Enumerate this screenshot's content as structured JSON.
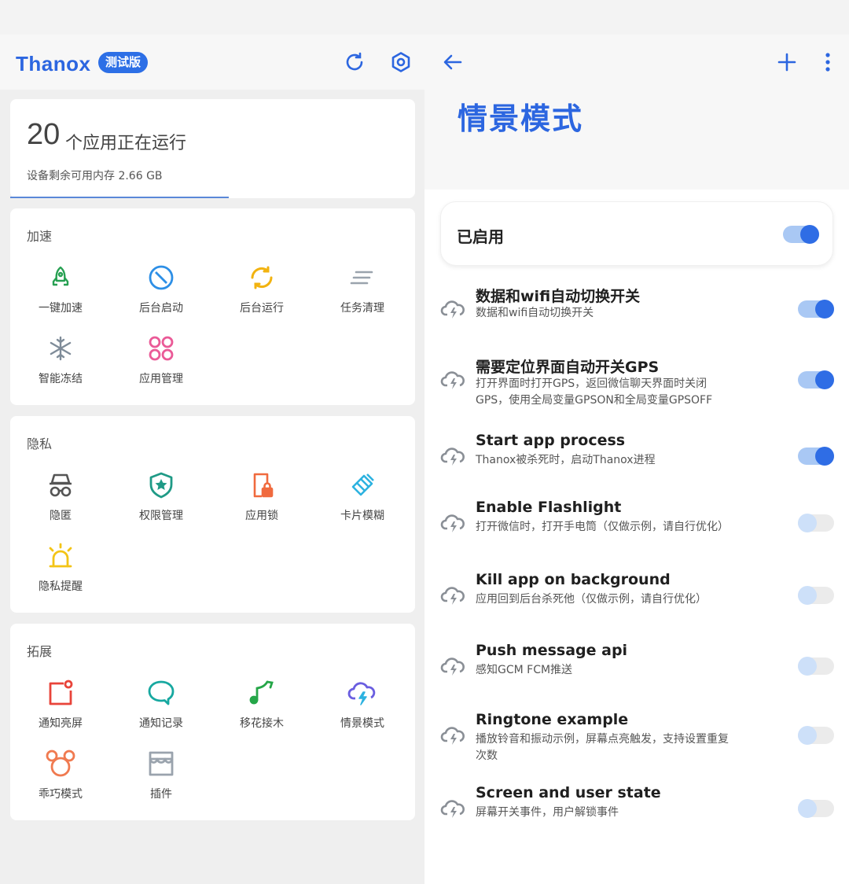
{
  "left": {
    "brand": "Thanox",
    "badge": "测试版",
    "toolbar_icons": [
      "refresh-icon",
      "settings-icon"
    ],
    "memory": {
      "count": "20",
      "label": "个应用正在运行",
      "available": "设备剩余可用内存 2.66 GB",
      "progress": 0.54
    },
    "sections": [
      {
        "title": "加速",
        "items": [
          {
            "label": "一键加速",
            "icon": "rocket-icon",
            "color": "#27a052"
          },
          {
            "label": "后台启动",
            "icon": "block-icon",
            "color": "#2d8fe6"
          },
          {
            "label": "后台运行",
            "icon": "sync-icon",
            "color": "#f2b310"
          },
          {
            "label": "任务清理",
            "icon": "clear-all-icon",
            "color": "#9aa3ad"
          },
          {
            "label": "智能冻结",
            "icon": "snowflake-icon",
            "color": "#7f8c99"
          },
          {
            "label": "应用管理",
            "icon": "apps-grid-icon",
            "color": "#ea5a97"
          }
        ]
      },
      {
        "title": "隐私",
        "items": [
          {
            "label": "隐匿",
            "icon": "incognito-icon",
            "color": "#555555"
          },
          {
            "label": "权限管理",
            "icon": "shield-star-icon",
            "color": "#1f9a86"
          },
          {
            "label": "应用锁",
            "icon": "phone-lock-icon",
            "color": "#f06a3e"
          },
          {
            "label": "卡片模糊",
            "icon": "eraser-icon",
            "color": "#2db2e0"
          },
          {
            "label": "隐私提醒",
            "icon": "alarm-light-icon",
            "color": "#f3c416"
          }
        ]
      },
      {
        "title": "拓展",
        "items": [
          {
            "label": "通知亮屏",
            "icon": "notification-badge-icon",
            "color": "#e8443a"
          },
          {
            "label": "通知记录",
            "icon": "chat-bubble-icon",
            "color": "#17a8a0"
          },
          {
            "label": "移花接木",
            "icon": "music-note-icon",
            "color": "#25a648"
          },
          {
            "label": "情景模式",
            "icon": "cloud-bolt-icon",
            "color": "#6a5ee0"
          },
          {
            "label": "乖巧模式",
            "icon": "mouse-ears-icon",
            "color": "#f07a50"
          },
          {
            "label": "插件",
            "icon": "store-icon",
            "color": "#9aa3ad"
          }
        ]
      }
    ]
  },
  "right": {
    "toolbar_icons": [
      "back-arrow-icon",
      "add-icon",
      "more-vert-icon"
    ],
    "title": "情景模式",
    "master_toggle": {
      "label": "已启用",
      "on": true
    },
    "items": [
      {
        "title": "数据和wifi自动切换开关",
        "desc": "数据和wifi自动切换开关",
        "on": true
      },
      {
        "title": "需要定位界面自动开关GPS",
        "desc": "打开界面时打开GPS，返回微信聊天界面时关闭GPS，使用全局变量GPSON和全局变量GPSOFF",
        "on": true
      },
      {
        "title": "Start app process",
        "desc": "Thanox被杀死时，启动Thanox进程",
        "on": true
      },
      {
        "title": "Enable Flashlight",
        "desc": "打开微信时，打开手电筒（仅做示例，请自行优化）",
        "on": false
      },
      {
        "title": "Kill app on background",
        "desc": "应用回到后台杀死他（仅做示例，请自行优化）",
        "on": false
      },
      {
        "title": "Push message api",
        "desc": "感知GCM FCM推送",
        "on": false
      },
      {
        "title": "Ringtone example",
        "desc": "播放铃音和振动示例，屏幕点亮触发，支持设置重复次数",
        "on": false
      },
      {
        "title": "Screen and user state",
        "desc": "屏幕开关事件，用户解锁事件",
        "on": false
      }
    ],
    "colors": {
      "accent": "#2c66e0",
      "switch_on": "#2f6de5",
      "switch_track_on": "#a9c8f4"
    }
  }
}
